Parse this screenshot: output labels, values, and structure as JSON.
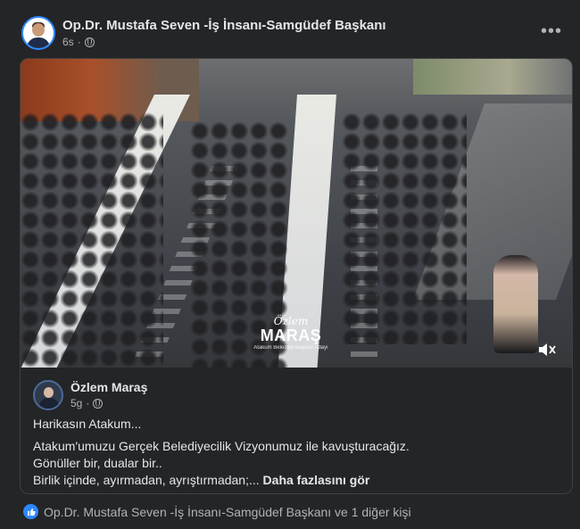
{
  "post": {
    "author": "Op.Dr. Mustafa Seven -İş İnsanı-Samgüdef Başkanı",
    "time": "6s",
    "visibility_icon": "globe-icon",
    "more_icon": "more-options-icon"
  },
  "shared_post": {
    "media": {
      "watermark_script": "Özlem",
      "watermark_name": "MARAŞ",
      "watermark_sub": "Atakum Belediye Başkan Adayı",
      "volume_icon": "volume-icon"
    },
    "author": "Özlem Maraş",
    "time": "5g",
    "visibility_icon": "globe-icon",
    "text": {
      "line1": "Harikasın Atakum...",
      "line2": "Atakum'umuzu Gerçek Belediyecilik Vizyonumuz ile kavuşturacağız.",
      "line3": "Gönüller bir, dualar bir..",
      "line4": "Birlik içinde, ayırmadan, ayrıştırmadan;...",
      "see_more": "Daha fazlasını gör"
    }
  },
  "reactions": {
    "icon": "like-icon",
    "text": "Op.Dr. Mustafa Seven -İş İnsanı-Samgüdef Başkanı ve 1 diğer kişi"
  },
  "colors": {
    "background": "#242526",
    "text_primary": "#e4e6eb",
    "text_secondary": "#b0b3b8",
    "accent": "#2d88ff"
  }
}
